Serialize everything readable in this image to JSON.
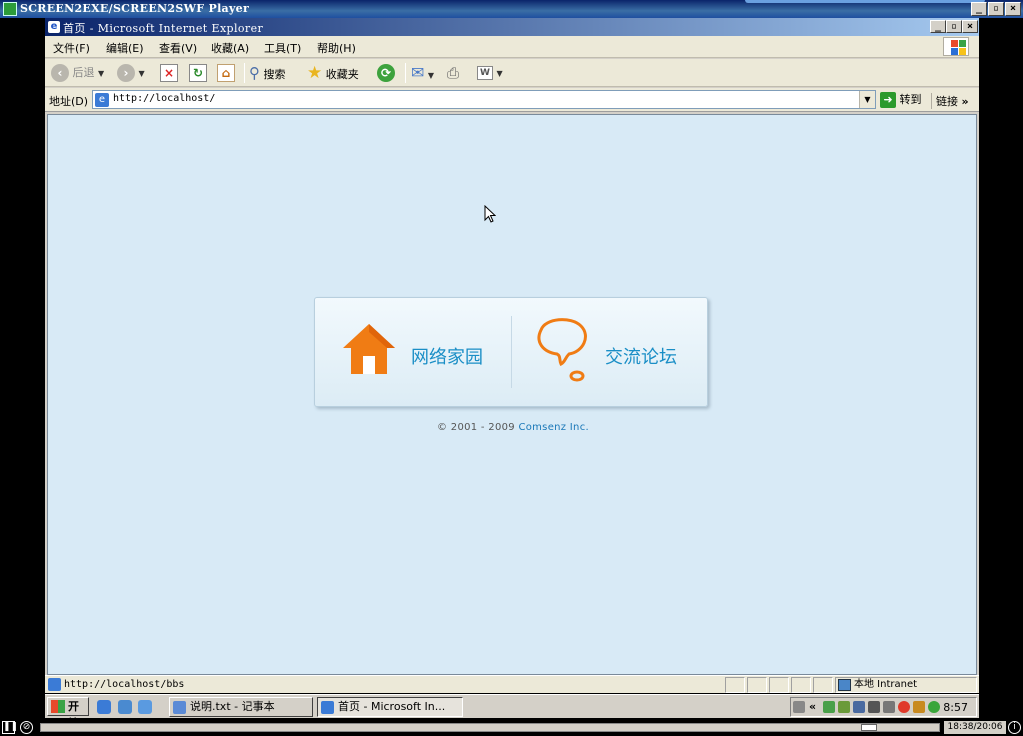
{
  "player": {
    "title": "SCREEN2EXE/SCREEN2SWF Player",
    "time": "18:38/20:06",
    "progress_fraction": 0.93
  },
  "ie": {
    "title": "首页 - Microsoft Internet Explorer",
    "menu": [
      "文件(F)",
      "编辑(E)",
      "查看(V)",
      "收藏(A)",
      "工具(T)",
      "帮助(H)"
    ],
    "toolbar": {
      "back": "后退",
      "search": "搜索",
      "favorites": "收藏夹"
    },
    "address": {
      "label": "地址(D)",
      "url": "http://localhost/",
      "go": "转到",
      "links": "链接"
    },
    "status": {
      "text": "http://localhost/bbs",
      "zone": "本地 Intranet"
    }
  },
  "page": {
    "link_home": "网络家园",
    "link_forum": "交流论坛",
    "copyright_prefix": "© 2001 - 2009 ",
    "copyright_company": "Comsenz Inc."
  },
  "taskbar": {
    "start": "开始",
    "tasks": [
      "说明.txt - 记事本",
      "首页 - Microsoft In..."
    ],
    "clock": "8:57"
  },
  "colors": {
    "page_bg": "#d8eaf6",
    "link_text": "#1a8ec6",
    "house_orange": "#f07c14",
    "title_blue": "#0a246a"
  }
}
